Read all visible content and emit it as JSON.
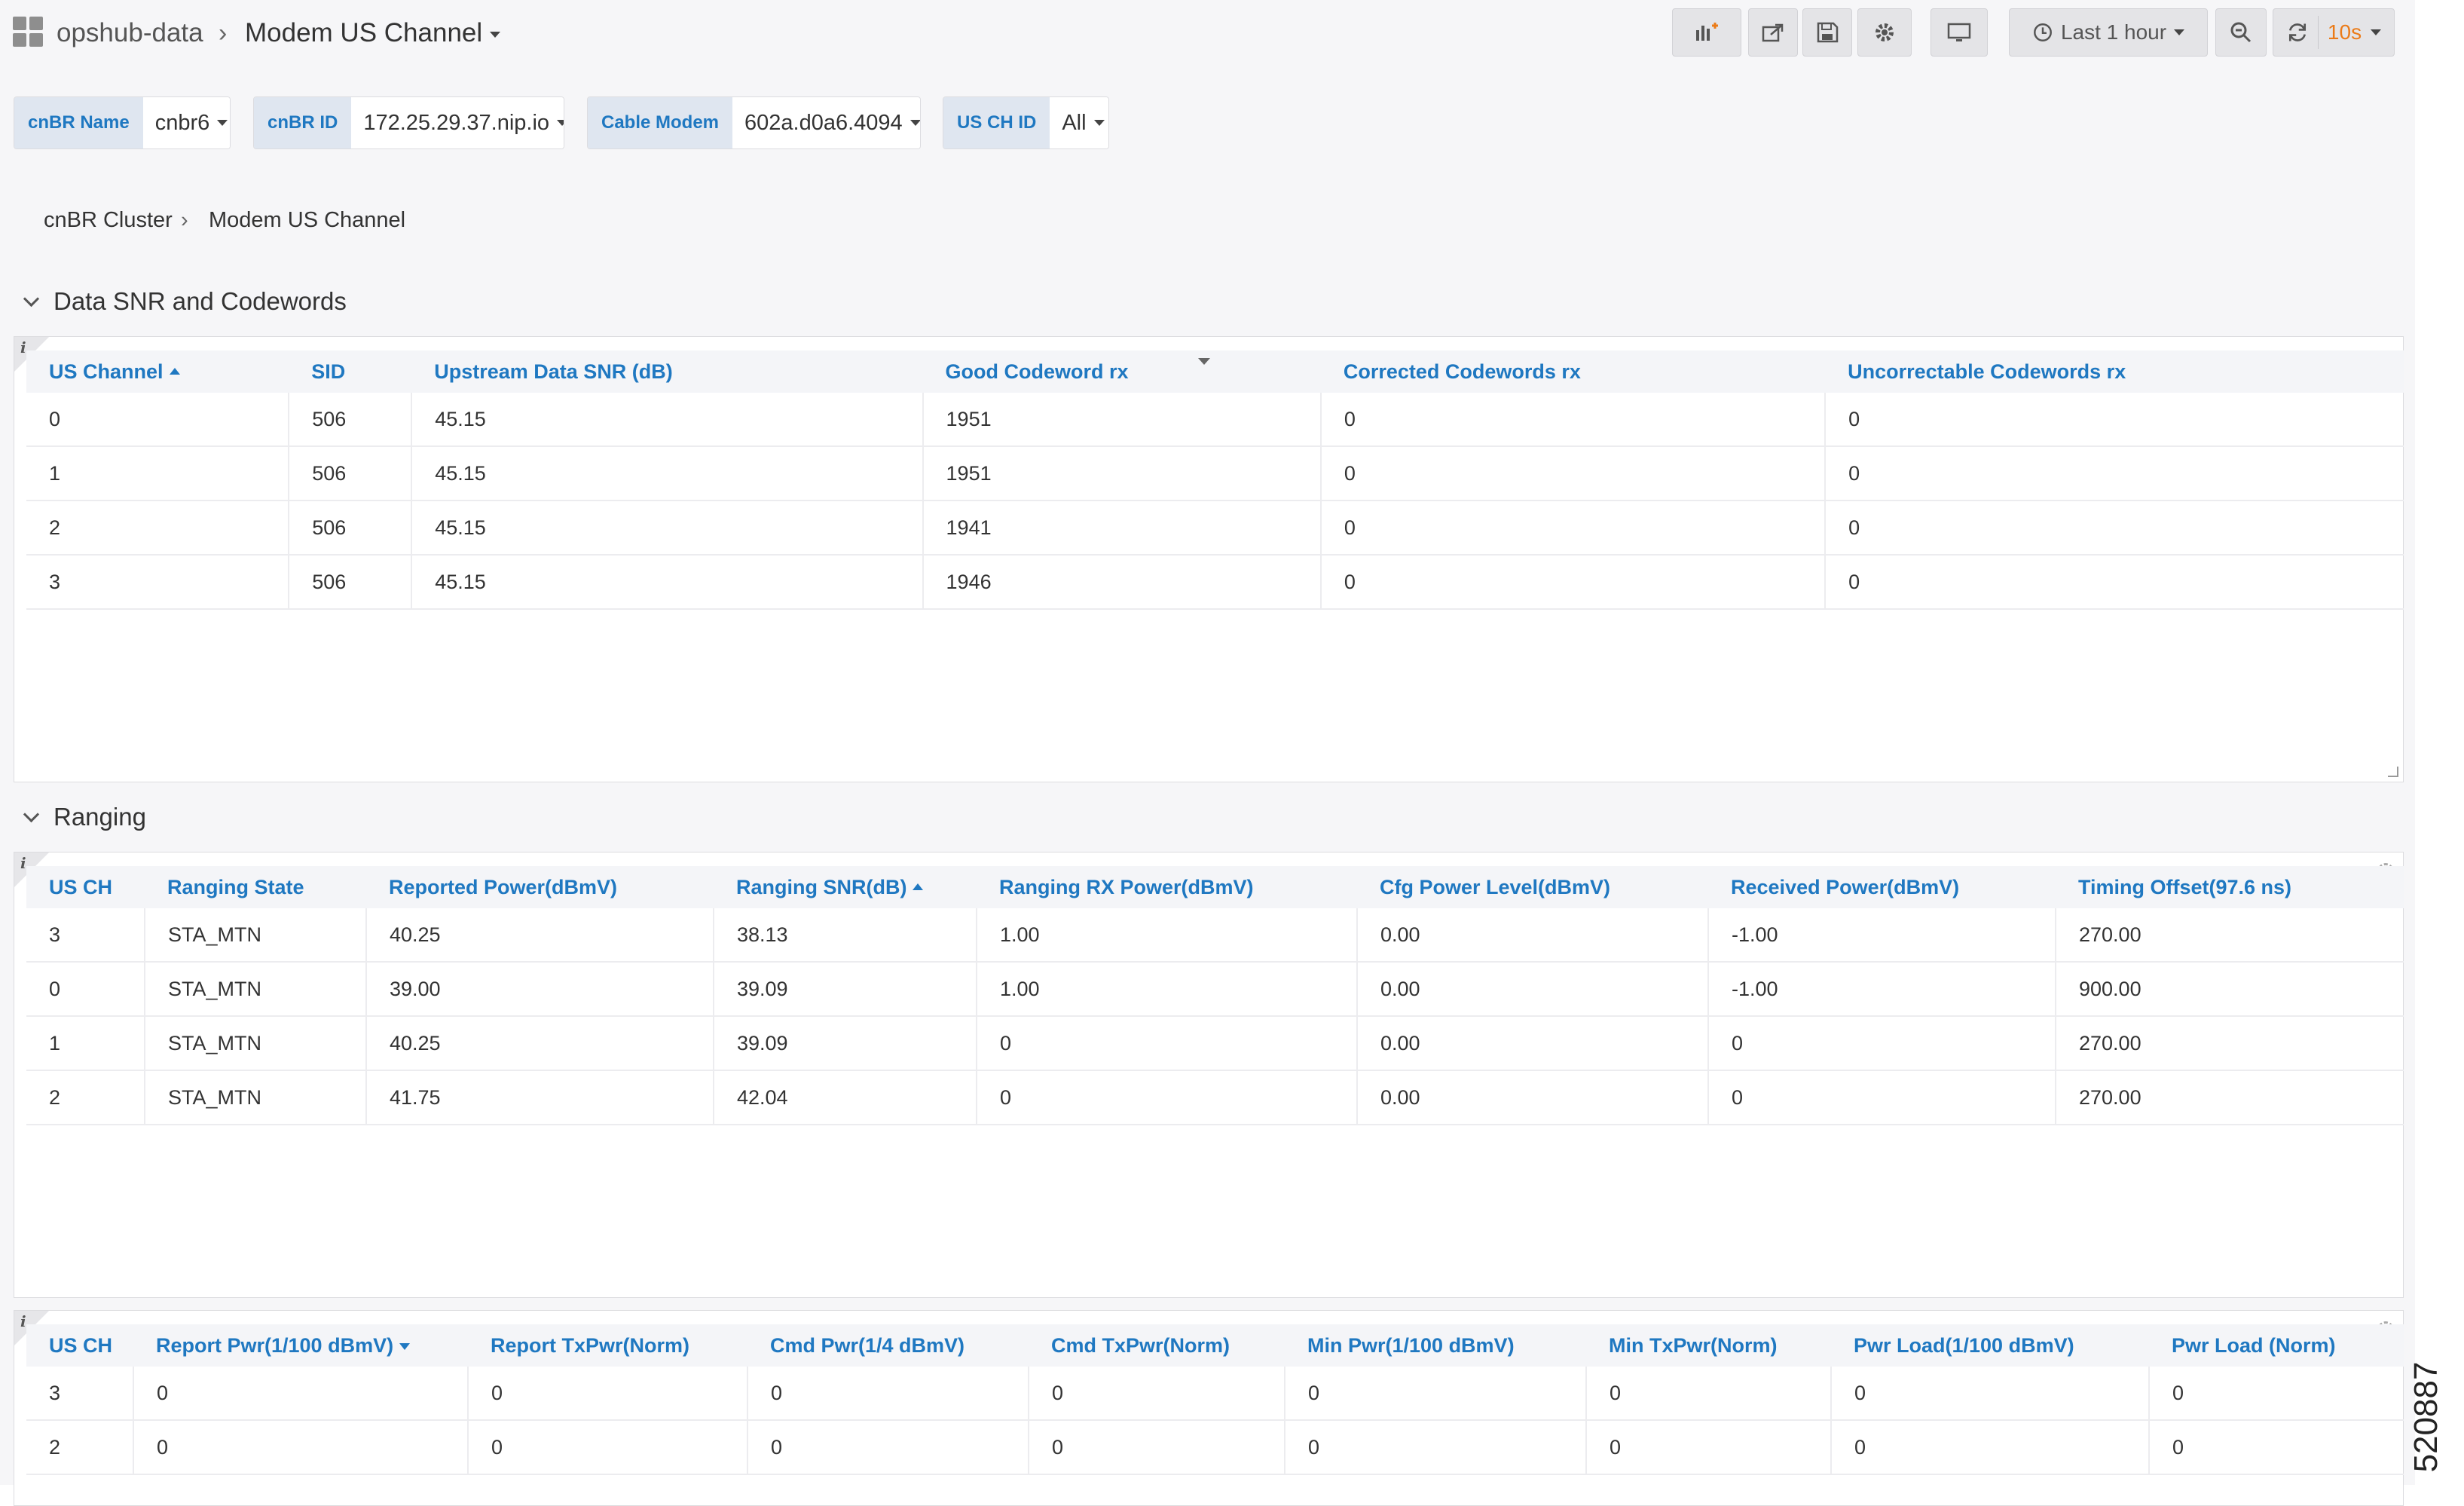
{
  "navbar": {
    "org": "opshub-data",
    "dashboard_title": "Modem US Channel",
    "time_range": "Last 1 hour",
    "refresh_interval": "10s"
  },
  "variables": [
    {
      "label": "cnBR Name",
      "value": "cnbr6"
    },
    {
      "label": "cnBR ID",
      "value": "172.25.29.37.nip.io"
    },
    {
      "label": "Cable Modem",
      "value": "602a.d0a6.4094"
    },
    {
      "label": "US CH ID",
      "value": "All"
    }
  ],
  "breadcrumb": [
    "cnBR Cluster",
    "Modem US Channel"
  ],
  "rows": [
    {
      "title": "Data SNR and Codewords"
    },
    {
      "title": "Ranging"
    }
  ],
  "tables": {
    "snr": {
      "columns": [
        "US Channel",
        "SID",
        "Upstream Data SNR (dB)",
        "Good Codeword rx",
        "Corrected Codewords rx",
        "Uncorrectable Codewords rx"
      ],
      "rows": [
        [
          "0",
          "506",
          "45.15",
          "1951",
          "0",
          "0"
        ],
        [
          "1",
          "506",
          "45.15",
          "1951",
          "0",
          "0"
        ],
        [
          "2",
          "506",
          "45.15",
          "1941",
          "0",
          "0"
        ],
        [
          "3",
          "506",
          "45.15",
          "1946",
          "0",
          "0"
        ]
      ]
    },
    "ranging": {
      "columns": [
        "US CH",
        "Ranging State",
        "Reported Power(dBmV)",
        "Ranging SNR(dB)",
        "Ranging RX Power(dBmV)",
        "Cfg Power Level(dBmV)",
        "Received Power(dBmV)",
        "Timing Offset(97.6 ns)"
      ],
      "rows": [
        [
          "3",
          "STA_MTN",
          "40.25",
          "38.13",
          "1.00",
          "0.00",
          "-1.00",
          "270.00"
        ],
        [
          "0",
          "STA_MTN",
          "39.00",
          "39.09",
          "1.00",
          "0.00",
          "-1.00",
          "900.00"
        ],
        [
          "1",
          "STA_MTN",
          "40.25",
          "39.09",
          "0",
          "0.00",
          "0",
          "270.00"
        ],
        [
          "2",
          "STA_MTN",
          "41.75",
          "42.04",
          "0",
          "0.00",
          "0",
          "270.00"
        ]
      ]
    },
    "power": {
      "columns": [
        "US CH",
        "Report Pwr(1/100 dBmV)",
        "Report TxPwr(Norm)",
        "Cmd Pwr(1/4 dBmV)",
        "Cmd TxPwr(Norm)",
        "Min Pwr(1/100 dBmV)",
        "Min TxPwr(Norm)",
        "Pwr Load(1/100 dBmV)",
        "Pwr Load (Norm)"
      ],
      "rows": [
        [
          "3",
          "0",
          "0",
          "0",
          "0",
          "0",
          "0",
          "0",
          "0"
        ],
        [
          "2",
          "0",
          "0",
          "0",
          "0",
          "0",
          "0",
          "0",
          "0"
        ]
      ]
    }
  },
  "panel_info_glyph": "i",
  "figure_id": "520887",
  "colors": {
    "accent": "#1f78c1",
    "refresh": "#eb7b18",
    "background": "#f6f6f8"
  }
}
